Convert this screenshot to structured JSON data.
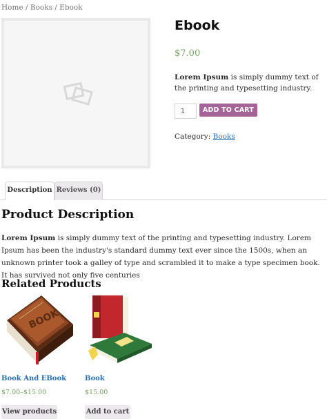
{
  "breadcrumb": {
    "text": "Home / Books / Ebook"
  },
  "product": {
    "title": "Ebook",
    "price": "$7.00",
    "short_desc_bold": "Lorem Ipsum",
    "short_desc_rest": " is simply dummy text of the printing and typesetting industry.",
    "quantity": "1",
    "add_to_cart_label": "ADD TO CART",
    "category_label": "Category:",
    "category_value": "Books"
  },
  "tabs": [
    {
      "label": "Description"
    },
    {
      "label": "Reviews (0)"
    }
  ],
  "description": {
    "heading": "Product Description",
    "bold": "Lorem Ipsum",
    "rest": " is simply dummy text of the printing and typesetting industry. Lorem Ipsum has been the industry's standard dummy text ever since the 1500s, when an unknown printer took a galley of type and scrambled it to make a type specimen book. It has survived not only five centuries"
  },
  "related": {
    "heading": "Related Products",
    "items": [
      {
        "name": "Book And EBook",
        "price": "$7.00–$15.00",
        "button": "View products"
      },
      {
        "name": "Book",
        "price": "$15.00",
        "button": "Add to cart"
      }
    ]
  },
  "colors": {
    "accent": "#a46497",
    "price": "#77a464",
    "link": "#2a6fb0"
  }
}
